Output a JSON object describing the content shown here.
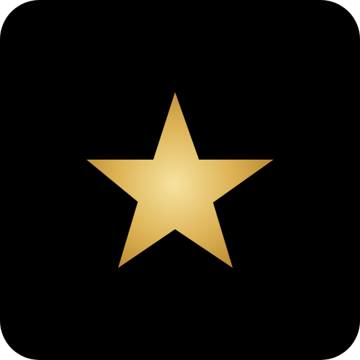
{
  "icon": {
    "name": "star-icon",
    "background_color": "#000000",
    "star_gradient": {
      "center": "#F6E3A0",
      "mid": "#DDB356",
      "edge": "#B8862E"
    }
  }
}
